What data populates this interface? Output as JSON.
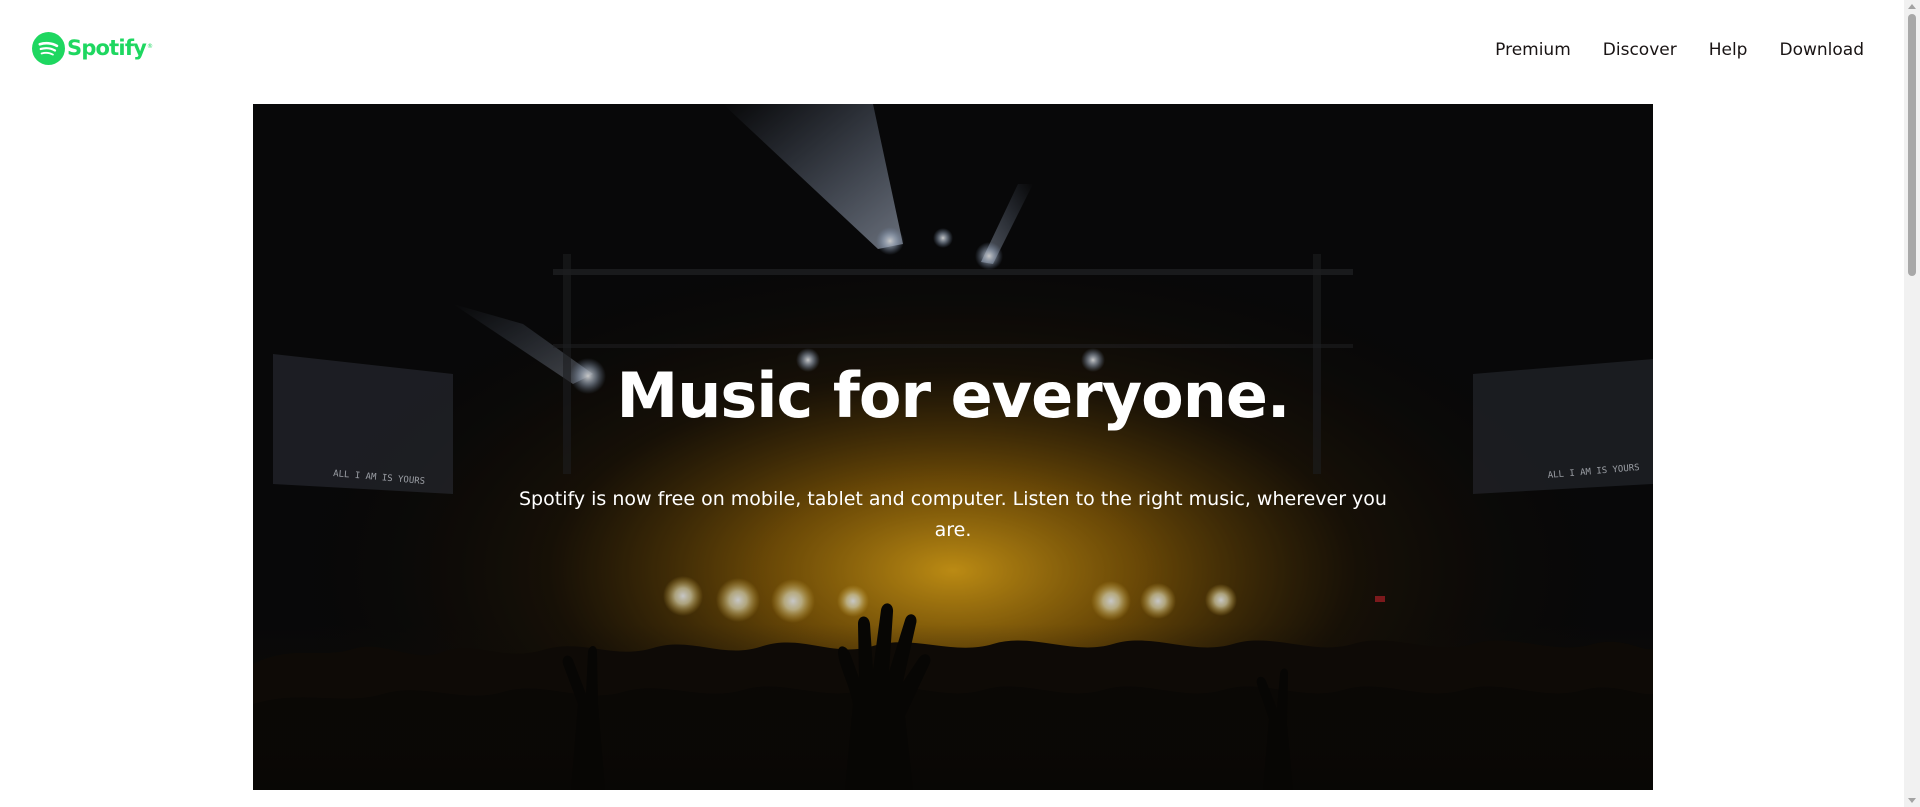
{
  "header": {
    "logo": {
      "wordmark": "Spotify",
      "trademark": "®",
      "icon": "spotify-logo-icon",
      "color": "#1ed760"
    },
    "nav": [
      {
        "label": "Premium"
      },
      {
        "label": "Discover"
      },
      {
        "label": "Help"
      },
      {
        "label": "Download"
      }
    ]
  },
  "hero": {
    "title": "Music for everyone.",
    "subtitle": "Spotify is now free on mobile, tablet and computer. Listen to the right music, wherever you are.",
    "background": "concert-crowd-photo",
    "screen_text_left": "ALL I AM IS YOURS",
    "screen_text_right": "ALL I AM IS YOURS",
    "glow_color": "#e0a10c",
    "overlay_color": "#000000"
  },
  "colors": {
    "page_background": "#ffffff",
    "nav_text": "#191414",
    "hero_text": "#ffffff",
    "brand_green": "#1ed760"
  }
}
